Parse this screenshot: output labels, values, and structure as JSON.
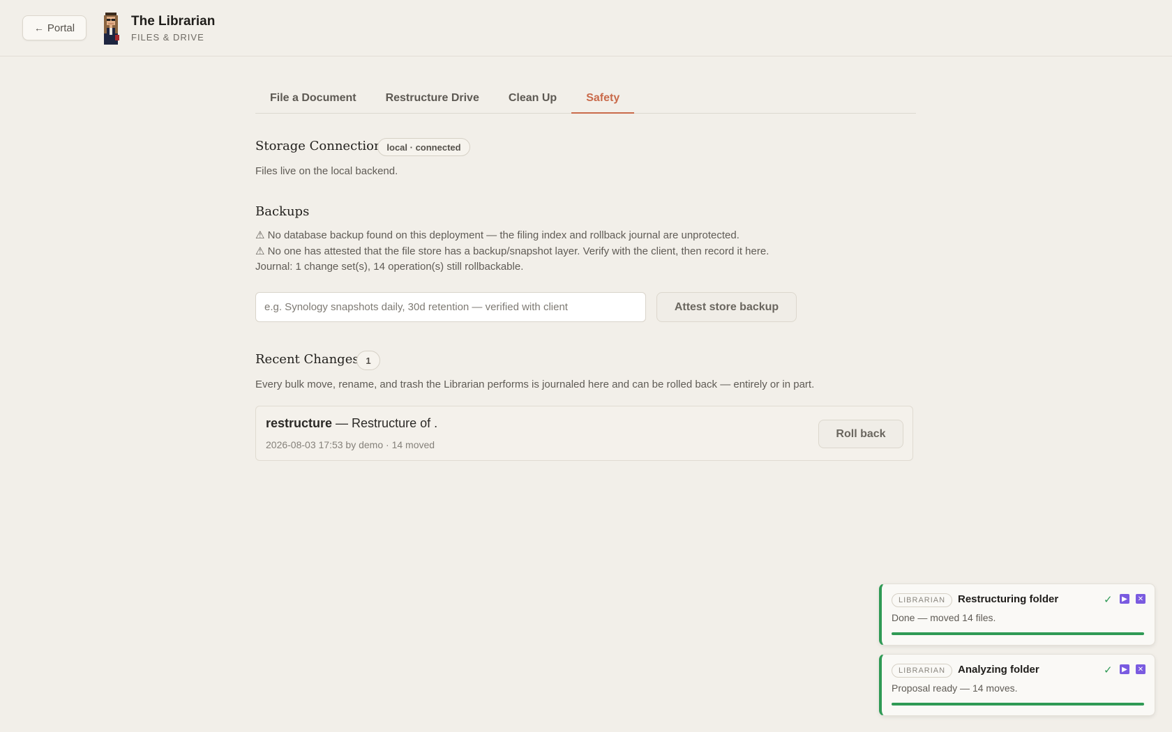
{
  "header": {
    "back_label": "Portal",
    "app_title": "The Librarian",
    "app_subtitle": "FILES & DRIVE"
  },
  "tabs": [
    {
      "label": "File a Document",
      "active": false
    },
    {
      "label": "Restructure Drive",
      "active": false
    },
    {
      "label": "Clean Up",
      "active": false
    },
    {
      "label": "Safety",
      "active": true
    }
  ],
  "storage": {
    "title": "Storage Connection",
    "status": "local · connected",
    "description": "Files live on the local backend."
  },
  "backups": {
    "title": "Backups",
    "warning_db": "⚠ No database backup found on this deployment — the filing index and rollback journal are unprotected.",
    "warning_store": "⚠ No one has attested that the file store has a backup/snapshot layer. Verify with the client, then record it here.",
    "journal": "Journal: 1 change set(s), 14 operation(s) still rollbackable.",
    "input_placeholder": "e.g. Synology snapshots daily, 30d retention — verified with client",
    "attest_label": "Attest store backup"
  },
  "recent_changes": {
    "title": "Recent Changes",
    "count": "1",
    "description": "Every bulk move, rename, and trash the Librarian performs is journaled here and can be rolled back — entirely or in part.",
    "items": [
      {
        "kind": "restructure",
        "summary": " — Restructure of .",
        "meta": "2026-08-03 17:53 by demo · 14 moved",
        "rollback_label": "Roll back"
      }
    ]
  },
  "toasts": [
    {
      "badge": "LIBRARIAN",
      "title": "Restructuring folder",
      "message": "Done — moved 14 files.",
      "progress": 1.0
    },
    {
      "badge": "LIBRARIAN",
      "title": "Analyzing folder",
      "message": "Proposal ready — 14 moves.",
      "progress": 1.0
    }
  ],
  "icons": {
    "back": "arrow-left-icon",
    "warning": "warning-triangle-icon",
    "done": "check-icon",
    "play": "play-icon",
    "close": "close-icon"
  },
  "colors": {
    "accent": "#c96a4a",
    "success": "#2f9a55",
    "toast_action": "#7a5be0"
  }
}
